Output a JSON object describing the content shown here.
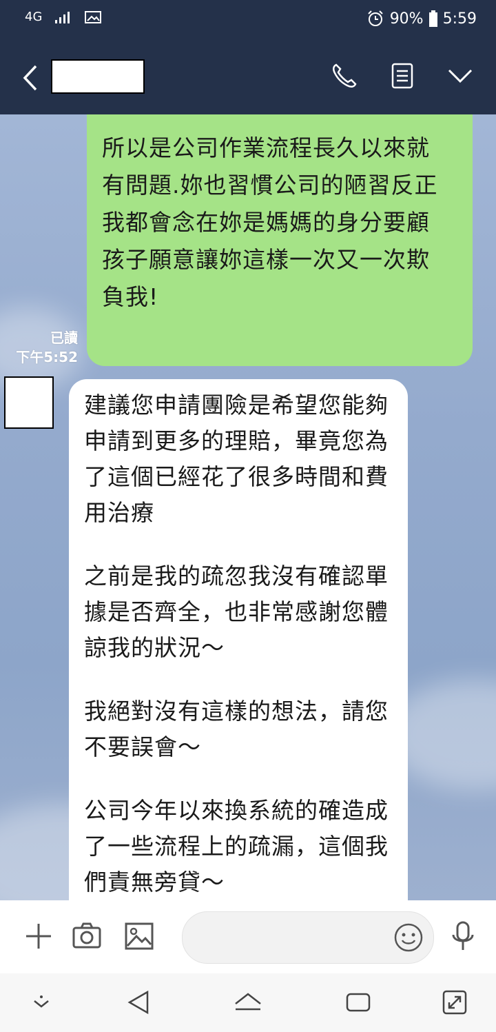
{
  "status_bar": {
    "network": "4G",
    "battery": "90%",
    "time": "5:59"
  },
  "header": {
    "contact_name": ""
  },
  "messages": {
    "sent": {
      "lines": [
        "所以是公司作業流程長久以來就",
        "有問題.妳也習慣公司的陋習反正",
        "我都會念在妳是媽媽的身分要顧",
        "孩子願意讓妳這樣一次又一次欺",
        "負我!"
      ],
      "read_label": "已讀",
      "time": "下午5:52"
    },
    "received": {
      "paragraphs": [
        "建議您申請團險是希望您能夠\n申請到更多的理賠，畢竟您為\n了這個已經花了很多時間和費\n用治療",
        "之前是我的疏忽我沒有確認單\n據是否齊全，也非常感謝您體\n諒我的狀況～",
        "我絕對沒有這樣的想法，請您\n不要誤會～",
        "公司今年以來換系統的確造成\n了一些流程上的疏漏，這個我\n們責無旁貸～"
      ]
    }
  },
  "icons": {
    "header": [
      "back-icon",
      "phone-icon",
      "menu-icon",
      "chevron-down-icon"
    ],
    "input_bar": [
      "plus-icon",
      "camera-icon",
      "image-icon",
      "emoji-icon",
      "mic-icon"
    ],
    "nav": [
      "down-arrow-icon",
      "back-nav-icon",
      "home-icon",
      "recents-icon",
      "expand-icon"
    ]
  },
  "colors": {
    "header_bg": "#24314a",
    "sent_bubble": "#a5e387",
    "received_bubble": "#ffffff"
  }
}
